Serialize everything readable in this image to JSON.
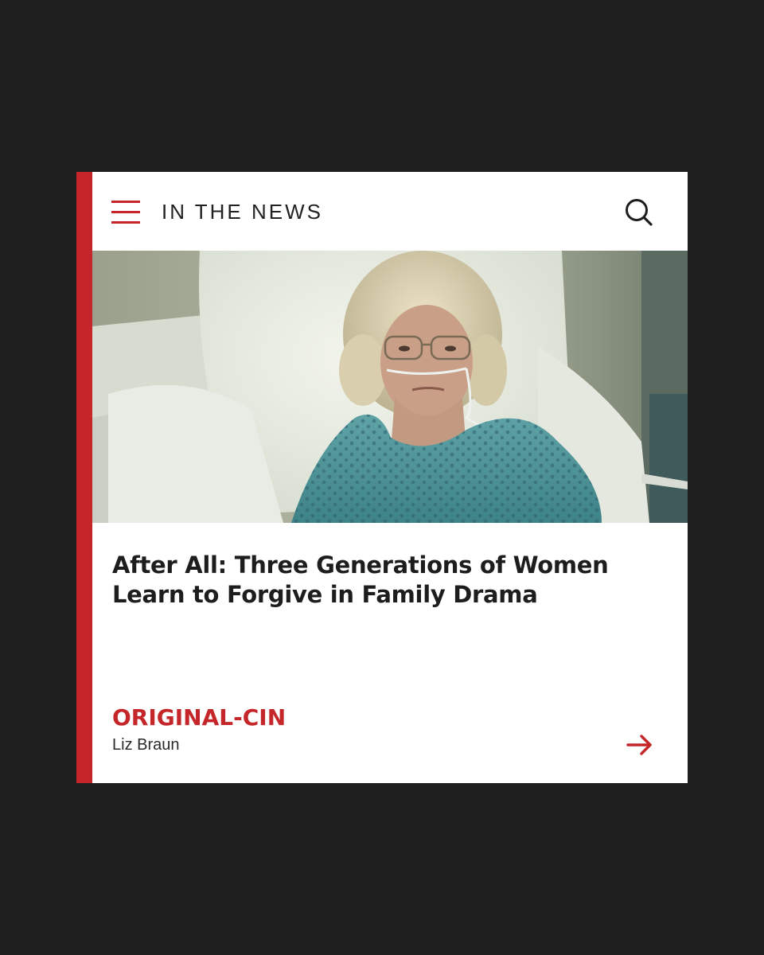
{
  "header": {
    "title": "IN THE NEWS",
    "menu_icon": "hamburger-menu-icon",
    "search_icon": "search-icon"
  },
  "hero": {
    "image_subject": "woman-in-hospital-bed-photo"
  },
  "article": {
    "headline": "After All: Three Generations of Women Learn to Forgive in Family Drama",
    "category": "ORIGINAL-CIN",
    "author": "Liz Braun",
    "arrow_icon": "arrow-right-icon"
  },
  "colors": {
    "accent": "#c4262a",
    "background": "#1f1f1f",
    "card": "#ffffff",
    "text": "#1d1d1d"
  }
}
